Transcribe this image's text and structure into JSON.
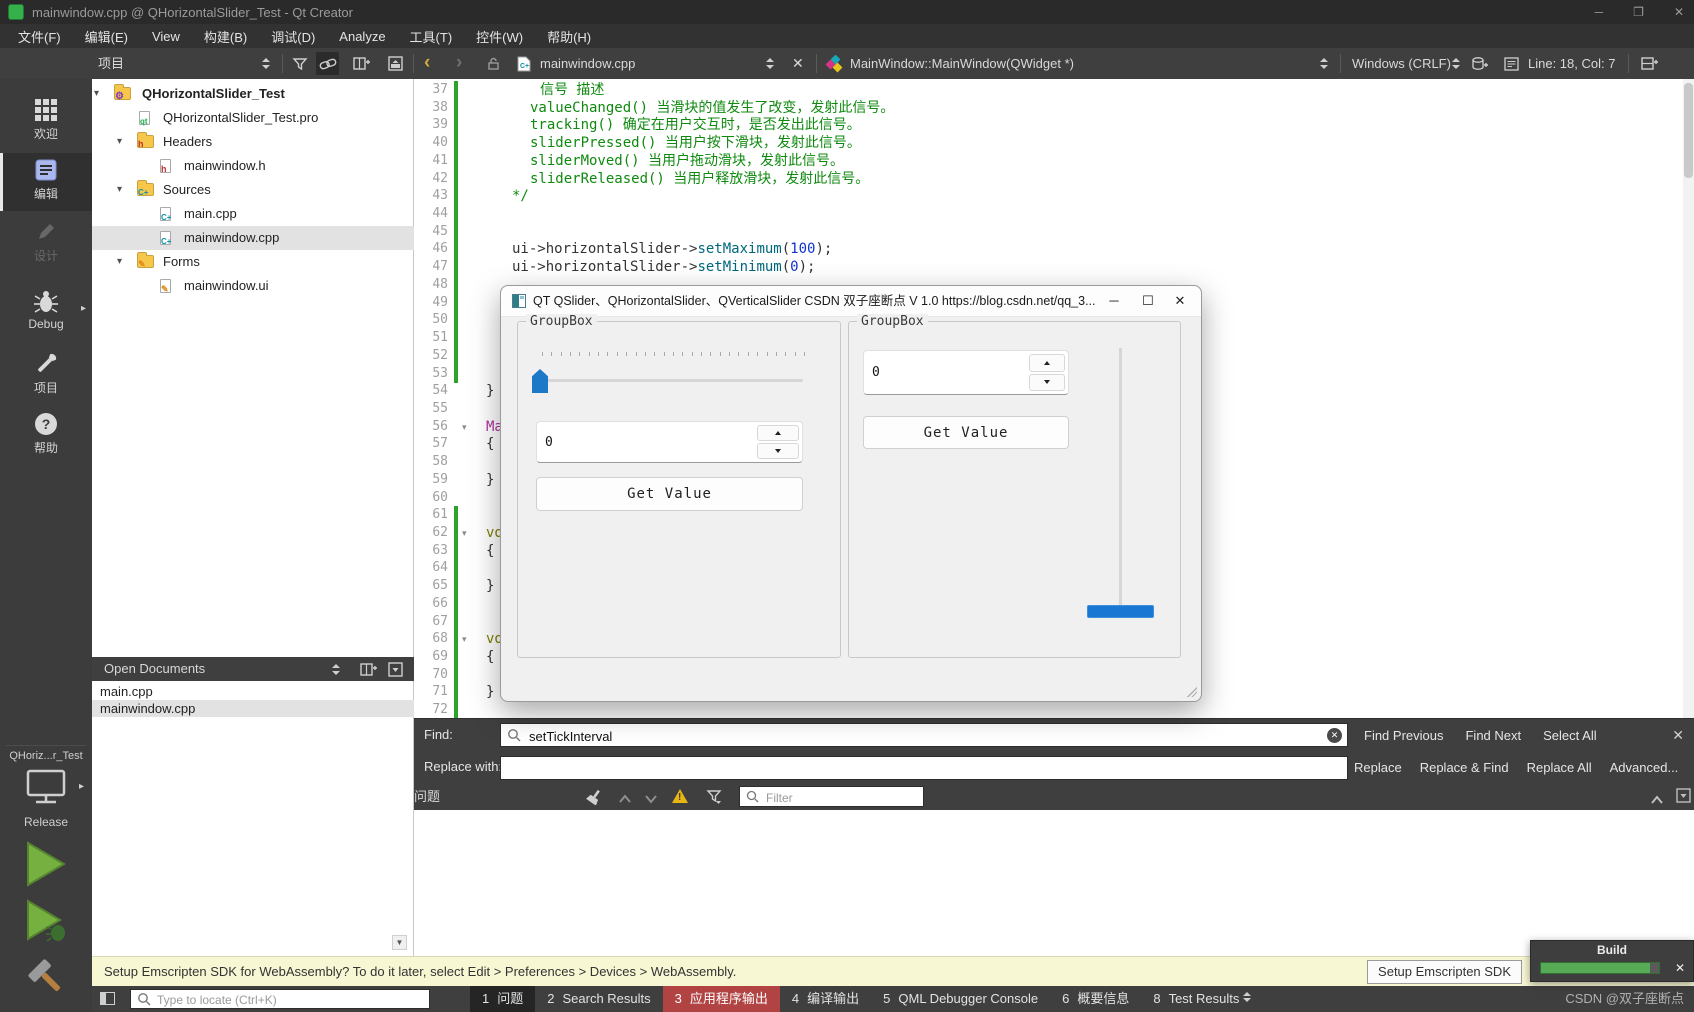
{
  "window": {
    "title": "mainwindow.cpp @ QHorizontalSlider_Test - Qt Creator"
  },
  "menubar": {
    "items": [
      {
        "id": "file",
        "label": "文件(F)"
      },
      {
        "id": "edit",
        "label": "编辑(E)"
      },
      {
        "id": "view",
        "label": "View"
      },
      {
        "id": "build",
        "label": "构建(B)"
      },
      {
        "id": "debug",
        "label": "调试(D)"
      },
      {
        "id": "analyze",
        "label": "Analyze"
      },
      {
        "id": "tools",
        "label": "工具(T)"
      },
      {
        "id": "widgets",
        "label": "控件(W)"
      },
      {
        "id": "help",
        "label": "帮助(H)"
      }
    ]
  },
  "toolbar": {
    "pane_selector": "项目",
    "document": "mainwindow.cpp",
    "symbol": "MainWindow::MainWindow(QWidget *)",
    "eol": "Windows (CRLF)",
    "cursor": "Line: 18, Col: 7"
  },
  "modebar": {
    "items": [
      {
        "id": "welcome",
        "label": "欢迎"
      },
      {
        "id": "edit",
        "label": "编辑"
      },
      {
        "id": "design",
        "label": "设计"
      },
      {
        "id": "debug",
        "label": "Debug"
      },
      {
        "id": "projects",
        "label": "项目"
      },
      {
        "id": "help",
        "label": "帮助"
      }
    ],
    "kit": {
      "project": "QHoriz...r_Test",
      "config": "Release"
    }
  },
  "project_tree": {
    "rows": [
      {
        "label": "QHorizontalSlider_Test",
        "depth": 0,
        "icon": "project",
        "bold": true,
        "expandable": true
      },
      {
        "label": "QHorizontalSlider_Test.pro",
        "depth": 1,
        "icon": "pro"
      },
      {
        "label": "Headers",
        "depth": 1,
        "icon": "folder-h",
        "expandable": true
      },
      {
        "label": "mainwindow.h",
        "depth": 2,
        "icon": "file-h"
      },
      {
        "label": "Sources",
        "depth": 1,
        "icon": "folder-cpp",
        "expandable": true
      },
      {
        "label": "main.cpp",
        "depth": 2,
        "icon": "file-cpp"
      },
      {
        "label": "mainwindow.cpp",
        "depth": 2,
        "icon": "file-cpp",
        "selected": true
      },
      {
        "label": "Forms",
        "depth": 1,
        "icon": "folder-ui",
        "expandable": true
      },
      {
        "label": "mainwindow.ui",
        "depth": 2,
        "icon": "file-ui"
      }
    ]
  },
  "open_documents": {
    "title": "Open Documents",
    "items": [
      {
        "label": "main.cpp"
      },
      {
        "label": "mainwindow.cpp",
        "selected": true
      }
    ]
  },
  "editor": {
    "lines": [
      {
        "n": 37,
        "bar": true,
        "ind": 54,
        "parts": [
          [
            "信号 描述",
            "com"
          ]
        ]
      },
      {
        "n": 38,
        "bar": true,
        "ind": 44,
        "parts": [
          [
            "valueChanged() 当滑块的值发生了改变，发射此信号。",
            "com"
          ]
        ]
      },
      {
        "n": 39,
        "bar": true,
        "ind": 44,
        "parts": [
          [
            "tracking() 确定在用户交互时，是否发出此信号。",
            "com"
          ]
        ]
      },
      {
        "n": 40,
        "bar": true,
        "ind": 44,
        "parts": [
          [
            "sliderPressed() 当用户按下滑块，发射此信号。",
            "com"
          ]
        ]
      },
      {
        "n": 41,
        "bar": true,
        "ind": 44,
        "parts": [
          [
            "sliderMoved() 当用户拖动滑块，发射此信号。",
            "com"
          ]
        ]
      },
      {
        "n": 42,
        "bar": true,
        "ind": 44,
        "parts": [
          [
            "sliderReleased() 当用户释放滑块，发射此信号。",
            "com"
          ]
        ]
      },
      {
        "n": 43,
        "bar": true,
        "ind": 26,
        "parts": [
          [
            "*/",
            "com"
          ]
        ]
      },
      {
        "n": 44,
        "bar": true
      },
      {
        "n": 45,
        "bar": true
      },
      {
        "n": 46,
        "bar": true,
        "ind": 26,
        "parts": [
          [
            "ui->horizontalSlider->",
            "pl"
          ],
          [
            "setMaximum",
            "fn"
          ],
          [
            "(",
            "pl"
          ],
          [
            "100",
            "num"
          ],
          [
            ");",
            "pl"
          ]
        ]
      },
      {
        "n": 47,
        "bar": true,
        "ind": 26,
        "parts": [
          [
            "ui->horizontalSlider->",
            "pl"
          ],
          [
            "setMinimum",
            "fn"
          ],
          [
            "(",
            "pl"
          ],
          [
            "0",
            "num"
          ],
          [
            ");",
            "pl"
          ]
        ]
      },
      {
        "n": 48,
        "bar": true
      },
      {
        "n": 49,
        "bar": true
      },
      {
        "n": 50,
        "bar": true
      },
      {
        "n": 51,
        "bar": true
      },
      {
        "n": 52,
        "bar": true
      },
      {
        "n": 53,
        "bar": true
      },
      {
        "n": 54,
        "parts": [
          [
            "}",
            "pl"
          ]
        ]
      },
      {
        "n": 55
      },
      {
        "n": 56,
        "fold": true,
        "parts": [
          [
            "Ma",
            "ty"
          ]
        ]
      },
      {
        "n": 57,
        "parts": [
          [
            "{",
            "pl"
          ]
        ]
      },
      {
        "n": 58
      },
      {
        "n": 59,
        "parts": [
          [
            "}",
            "pl"
          ]
        ]
      },
      {
        "n": 60
      },
      {
        "n": 61,
        "bar": true
      },
      {
        "n": 62,
        "bar": true,
        "fold": true,
        "parts": [
          [
            "vo",
            "kw"
          ]
        ]
      },
      {
        "n": 63,
        "bar": true,
        "parts": [
          [
            "{",
            "pl"
          ]
        ]
      },
      {
        "n": 64,
        "bar": true
      },
      {
        "n": 65,
        "bar": true,
        "parts": [
          [
            "}",
            "pl"
          ]
        ]
      },
      {
        "n": 66,
        "bar": true
      },
      {
        "n": 67,
        "bar": true
      },
      {
        "n": 68,
        "bar": true,
        "fold": true,
        "parts": [
          [
            "vo",
            "kw"
          ]
        ]
      },
      {
        "n": 69,
        "bar": true,
        "parts": [
          [
            "{",
            "pl"
          ]
        ]
      },
      {
        "n": 70,
        "bar": true
      },
      {
        "n": 71,
        "bar": true,
        "parts": [
          [
            "}",
            "pl"
          ]
        ]
      },
      {
        "n": 72,
        "bar": true
      }
    ]
  },
  "dialog": {
    "title": "QT QSlider、QHorizontalSlider、QVerticalSlider CSDN 双子座断点 V 1.0 https://blog.csdn.net/qq_3...",
    "left_group": {
      "label": "GroupBox",
      "spin_value": "0",
      "button": "Get Value",
      "slider_value": 0
    },
    "right_group": {
      "label": "GroupBox",
      "spin_value": "0",
      "button": "Get Value",
      "slider_value": 0
    }
  },
  "find_bar": {
    "find_label": "Find:",
    "find_value": "setTickInterval",
    "replace_label": "Replace with:",
    "row1_buttons": [
      {
        "id": "find-previous",
        "label": "Find Previous"
      },
      {
        "id": "find-next",
        "label": "Find Next"
      },
      {
        "id": "select-all",
        "label": "Select All"
      }
    ],
    "row2_buttons": [
      {
        "id": "replace",
        "label": "Replace"
      },
      {
        "id": "replace-and-find",
        "label": "Replace & Find"
      },
      {
        "id": "replace-all",
        "label": "Replace All"
      },
      {
        "id": "advanced",
        "label": "Advanced..."
      }
    ]
  },
  "issues_panel": {
    "title": "问题",
    "filter_placeholder": "Filter"
  },
  "info_bar": {
    "message": "Setup Emscripten SDK for WebAssembly? To do it later, select Edit > Preferences > Devices > WebAssembly.",
    "button": "Setup Emscripten SDK"
  },
  "build_popup": {
    "label": "Build",
    "progress_percent": 92,
    "bar_color": "#57ab57"
  },
  "status_bar": {
    "locator_placeholder": "Type to locate (Ctrl+K)",
    "tabs": [
      {
        "n": "1",
        "label": "问题",
        "state": "selected"
      },
      {
        "n": "2",
        "label": "Search Results"
      },
      {
        "n": "3",
        "label": "应用程序输出",
        "state": "alert"
      },
      {
        "n": "4",
        "label": "编译输出"
      },
      {
        "n": "5",
        "label": "QML Debugger Console"
      },
      {
        "n": "6",
        "label": "概要信息"
      },
      {
        "n": "8",
        "label": "Test Results"
      }
    ],
    "watermark": "CSDN @双子座断点"
  },
  "colors": {
    "accent_blue": "#1e78c8",
    "change_bar_green": "#2da32d",
    "alert_red": "#b24343",
    "progress_green": "#57ab57"
  }
}
